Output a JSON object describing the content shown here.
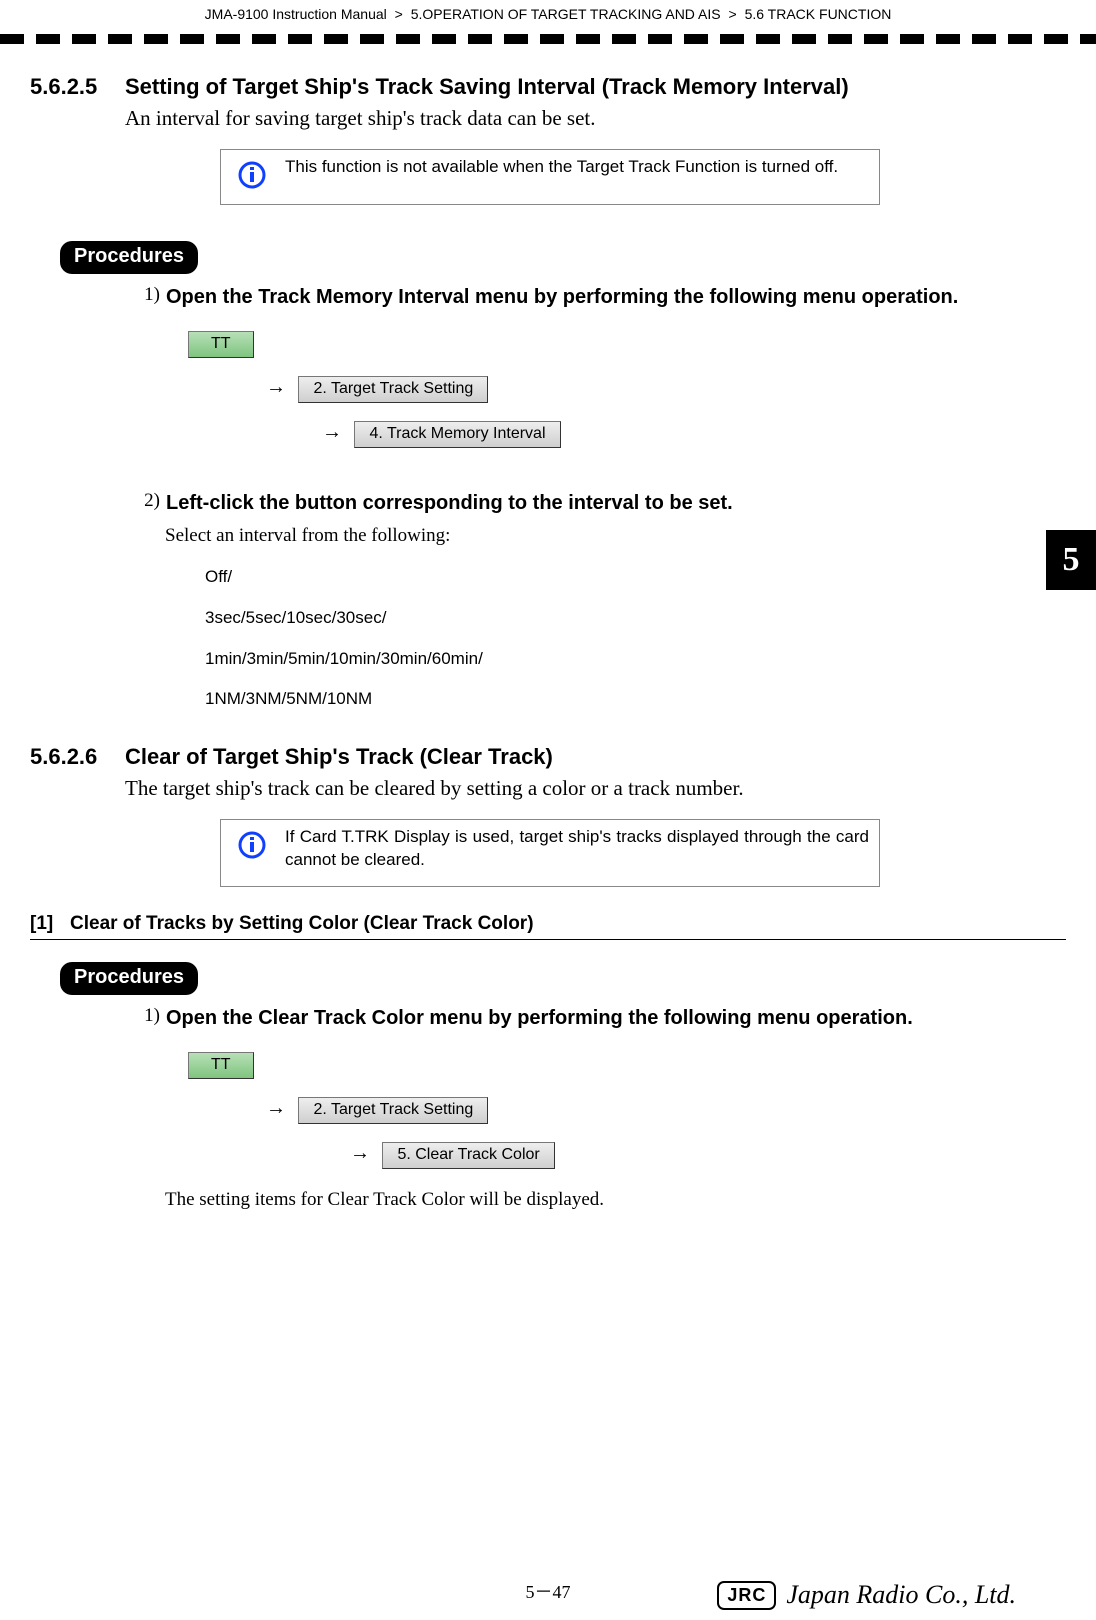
{
  "header": {
    "manual": "JMA-9100 Instruction Manual",
    "chapter": "5.OPERATION OF TARGET TRACKING AND AIS",
    "section": "5.6  TRACK FUNCTION",
    "sep": ">"
  },
  "tab": "5",
  "sec1": {
    "num": "5.6.2.5",
    "title": "Setting of Target Ship's Track Saving Interval (Track Memory Interval)",
    "body": "An interval for saving target ship's track data can be set.",
    "info": "This function is not available when the Target Track Function is turned off."
  },
  "proc_label": "Procedures",
  "proc1": {
    "s1": {
      "n": "1)",
      "t": "Open the Track Memory Interval menu by performing the following menu operation.",
      "m1": "TT",
      "m2": "2. Target Track Setting",
      "m3": "4. Track Memory Interval",
      "arrow": "→"
    },
    "s2": {
      "n": "2)",
      "t": "Left-click the button corresponding to the interval to be set.",
      "b": "Select an interval from the following:",
      "opts": {
        "l1": "Off/",
        "l2": "3sec/5sec/10sec/30sec/",
        "l3": "1min/3min/5min/10min/30min/60min/",
        "l4": "1NM/3NM/5NM/10NM"
      }
    }
  },
  "sec2": {
    "num": "5.6.2.6",
    "title": "Clear of Target Ship's Track (Clear Track)",
    "body": "The target ship's track can be cleared by setting a color or a track number.",
    "info": "If Card T.TRK Display is used, target ship's tracks displayed through the card cannot be cleared."
  },
  "sub": {
    "n": "[1]",
    "t": "Clear of Tracks by Setting Color (Clear Track Color)"
  },
  "proc2": {
    "s1": {
      "n": "1)",
      "t": "Open the Clear Track Color menu by performing the following menu operation.",
      "m1": "TT",
      "m2": "2. Target Track Setting",
      "m3": "5. Clear Track Color",
      "arrow": "→",
      "after": "The setting items for Clear Track Color will be displayed."
    }
  },
  "footer": {
    "page": "5－47",
    "jrc": "JRC",
    "brand": "Japan Radio Co., Ltd."
  }
}
